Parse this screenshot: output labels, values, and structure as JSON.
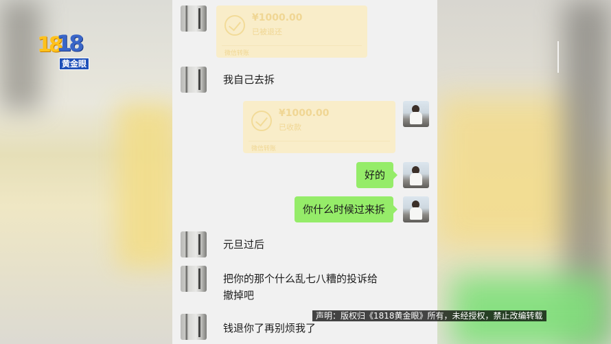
{
  "logo": {
    "number": "1818",
    "number_part1": "18",
    "number_part2": "18",
    "tag": "黄金眼"
  },
  "chat": {
    "messages": [
      {
        "side": "left",
        "type": "transfer",
        "amount": "¥1000.00",
        "status": "已被退还",
        "foot": "微信转账"
      },
      {
        "side": "left",
        "type": "text",
        "text": "我自己去拆"
      },
      {
        "side": "right",
        "type": "transfer",
        "amount": "¥1000.00",
        "status": "已收款",
        "foot": "微信转账"
      },
      {
        "side": "right",
        "type": "text",
        "text": "好的"
      },
      {
        "side": "right",
        "type": "text",
        "text": "你什么时候过来拆"
      },
      {
        "side": "left",
        "type": "text",
        "text": "元旦过后"
      },
      {
        "side": "left",
        "type": "text",
        "text": "把你的那个什么乱七八糟的投诉给",
        "text_line2": "撤掉吧"
      },
      {
        "side": "left",
        "type": "text",
        "text": "钱退你了再别烦我了"
      }
    ]
  },
  "disclaimer": "声明：版权归《1818黄金眼》所有，未经授权，禁止改编转载",
  "colors": {
    "green_bubble": "#95ec69",
    "transfer_card": "#faedc5",
    "chat_bg": "#f1f1f1",
    "logo_tag": "#1d4fb8"
  }
}
